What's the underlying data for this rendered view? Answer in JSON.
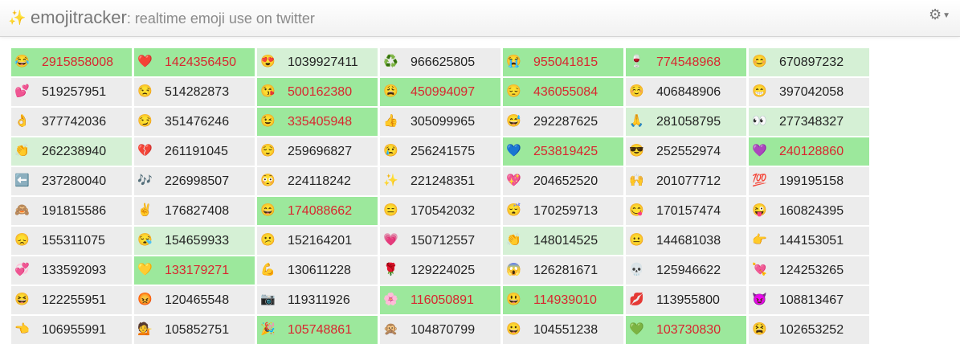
{
  "header": {
    "brand": "emojitracker",
    "tagline": ": realtime emoji use on twitter",
    "logo_icon": "shooting-star-icon",
    "settings_icon": "gears-icon"
  },
  "colors": {
    "highlight": "#9ce89c",
    "highlight_light": "#d5f0d5",
    "highlight_text": "#d9262f",
    "cell_bg": "#ececec"
  },
  "cells": [
    {
      "emoji": "😂",
      "count": "2915858008",
      "state": "hl"
    },
    {
      "emoji": "❤️",
      "count": "1424356450",
      "state": "hl"
    },
    {
      "emoji": "😍",
      "count": "1039927411",
      "state": "lt"
    },
    {
      "emoji": "♻️",
      "count": "966625805",
      "state": ""
    },
    {
      "emoji": "😭",
      "count": "955041815",
      "state": "hl"
    },
    {
      "emoji": "🍷",
      "count": "774548968",
      "state": "hl"
    },
    {
      "emoji": "😊",
      "count": "670897232",
      "state": "lt"
    },
    {
      "emoji": "💕",
      "count": "519257951",
      "state": ""
    },
    {
      "emoji": "😒",
      "count": "514282873",
      "state": ""
    },
    {
      "emoji": "😘",
      "count": "500162380",
      "state": "hl"
    },
    {
      "emoji": "😩",
      "count": "450994097",
      "state": "hl"
    },
    {
      "emoji": "😔",
      "count": "436055084",
      "state": "hl"
    },
    {
      "emoji": "☺️",
      "count": "406848906",
      "state": ""
    },
    {
      "emoji": "😁",
      "count": "397042058",
      "state": ""
    },
    {
      "emoji": "👌",
      "count": "377742036",
      "state": ""
    },
    {
      "emoji": "😏",
      "count": "351476246",
      "state": ""
    },
    {
      "emoji": "😉",
      "count": "335405948",
      "state": "hl"
    },
    {
      "emoji": "👍",
      "count": "305099965",
      "state": ""
    },
    {
      "emoji": "😅",
      "count": "292287625",
      "state": ""
    },
    {
      "emoji": "🙏",
      "count": "281058795",
      "state": "lt"
    },
    {
      "emoji": "👀",
      "count": "277348327",
      "state": "lt"
    },
    {
      "emoji": "👏",
      "count": "262238940",
      "state": "lt"
    },
    {
      "emoji": "💔",
      "count": "261191045",
      "state": ""
    },
    {
      "emoji": "😌",
      "count": "259696827",
      "state": ""
    },
    {
      "emoji": "😢",
      "count": "256241575",
      "state": ""
    },
    {
      "emoji": "💙",
      "count": "253819425",
      "state": "hl"
    },
    {
      "emoji": "😎",
      "count": "252552974",
      "state": ""
    },
    {
      "emoji": "💜",
      "count": "240128860",
      "state": "hl"
    },
    {
      "emoji": "⬅️",
      "count": "237280040",
      "state": ""
    },
    {
      "emoji": "🎶",
      "count": "226998507",
      "state": ""
    },
    {
      "emoji": "😳",
      "count": "224118242",
      "state": ""
    },
    {
      "emoji": "✨",
      "count": "221248351",
      "state": ""
    },
    {
      "emoji": "💖",
      "count": "204652520",
      "state": ""
    },
    {
      "emoji": "🙌",
      "count": "201077712",
      "state": ""
    },
    {
      "emoji": "💯",
      "count": "199195158",
      "state": ""
    },
    {
      "emoji": "🙈",
      "count": "191815586",
      "state": ""
    },
    {
      "emoji": "✌️",
      "count": "176827408",
      "state": ""
    },
    {
      "emoji": "😄",
      "count": "174088662",
      "state": "hl"
    },
    {
      "emoji": "😑",
      "count": "170542032",
      "state": ""
    },
    {
      "emoji": "😴",
      "count": "170259713",
      "state": ""
    },
    {
      "emoji": "😋",
      "count": "170157474",
      "state": ""
    },
    {
      "emoji": "😜",
      "count": "160824395",
      "state": ""
    },
    {
      "emoji": "😞",
      "count": "155311075",
      "state": ""
    },
    {
      "emoji": "😪",
      "count": "154659933",
      "state": "lt"
    },
    {
      "emoji": "😕",
      "count": "152164201",
      "state": ""
    },
    {
      "emoji": "💗",
      "count": "150712557",
      "state": ""
    },
    {
      "emoji": "👏",
      "count": "148014525",
      "state": "lt"
    },
    {
      "emoji": "😐",
      "count": "144681038",
      "state": ""
    },
    {
      "emoji": "👉",
      "count": "144153051",
      "state": ""
    },
    {
      "emoji": "💞",
      "count": "133592093",
      "state": ""
    },
    {
      "emoji": "💛",
      "count": "133179271",
      "state": "hl"
    },
    {
      "emoji": "💪",
      "count": "130611228",
      "state": ""
    },
    {
      "emoji": "🌹",
      "count": "129224025",
      "state": ""
    },
    {
      "emoji": "😱",
      "count": "126281671",
      "state": ""
    },
    {
      "emoji": "💀",
      "count": "125946622",
      "state": ""
    },
    {
      "emoji": "💘",
      "count": "124253265",
      "state": ""
    },
    {
      "emoji": "😆",
      "count": "122255951",
      "state": ""
    },
    {
      "emoji": "😡",
      "count": "120465548",
      "state": ""
    },
    {
      "emoji": "📷",
      "count": "119311926",
      "state": ""
    },
    {
      "emoji": "🌸",
      "count": "116050891",
      "state": "hl"
    },
    {
      "emoji": "😃",
      "count": "114939010",
      "state": "hl"
    },
    {
      "emoji": "💋",
      "count": "113955800",
      "state": ""
    },
    {
      "emoji": "😈",
      "count": "108813467",
      "state": ""
    },
    {
      "emoji": "👈",
      "count": "106955991",
      "state": ""
    },
    {
      "emoji": "💁",
      "count": "105852751",
      "state": ""
    },
    {
      "emoji": "🎉",
      "count": "105748861",
      "state": "hl"
    },
    {
      "emoji": "🙊",
      "count": "104870799",
      "state": ""
    },
    {
      "emoji": "😀",
      "count": "104551238",
      "state": ""
    },
    {
      "emoji": "💚",
      "count": "103730830",
      "state": "hl"
    },
    {
      "emoji": "😫",
      "count": "102653252",
      "state": ""
    }
  ]
}
